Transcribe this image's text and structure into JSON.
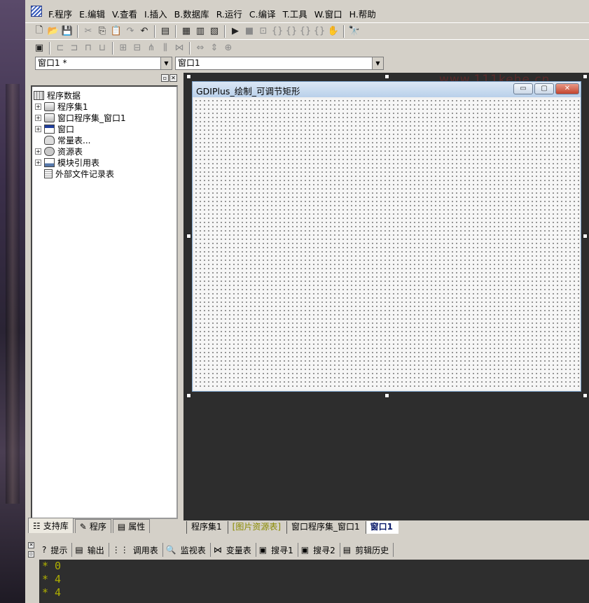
{
  "menubar": {
    "items": [
      "F.程序",
      "E.编辑",
      "V.查看",
      "I.插入",
      "B.数据库",
      "R.运行",
      "C.编译",
      "T.工具",
      "W.窗口",
      "H.帮助"
    ]
  },
  "toolbar1": {
    "icons": [
      "new-file-icon",
      "open-folder-icon",
      "save-icon",
      "cut-icon",
      "copy-icon",
      "paste-icon",
      "redo-icon",
      "undo-icon",
      "find-icon",
      "layout1-icon",
      "layout2-icon",
      "layout3-icon",
      "run-icon",
      "stop-icon",
      "step-icon",
      "step-in-icon",
      "step-out-icon",
      "step-over-icon",
      "breakpoint-icon",
      "hand-icon",
      "binoculars-icon"
    ]
  },
  "combos": {
    "left_value": "窗口1 *",
    "right_value": "窗口1"
  },
  "tree": {
    "root_label": "程序数据",
    "items": [
      {
        "label": "程序集1",
        "icon": "assembly-icon",
        "expandable": true
      },
      {
        "label": "窗口程序集_窗口1",
        "icon": "assembly-icon",
        "expandable": true
      },
      {
        "label": "窗口",
        "icon": "window-icon",
        "expandable": true
      },
      {
        "label": "常量表...",
        "icon": "constants-icon",
        "expandable": false
      },
      {
        "label": "资源表",
        "icon": "resource-icon",
        "expandable": true
      },
      {
        "label": "模块引用表",
        "icon": "module-icon",
        "expandable": true
      },
      {
        "label": "外部文件记录表",
        "icon": "document-icon",
        "expandable": false
      }
    ]
  },
  "left_tabs": {
    "support": "支持库",
    "program": "程序",
    "property": "属性"
  },
  "watermark": "www.111kehe.cn",
  "form": {
    "title": "GDIPlus_绘制_可调节矩形",
    "min_glyph": "▭",
    "max_glyph": "▢",
    "close_glyph": "✕"
  },
  "doc_tabs": [
    "程序集1",
    "[图片资源表]",
    "窗口程序集_窗口1",
    "窗口1"
  ],
  "output_tabs": [
    "提示",
    "输出",
    "调用表",
    "监视表",
    "变量表",
    "搜寻1",
    "搜寻2",
    "剪辑历史"
  ],
  "console_lines": [
    "* 0",
    "* 4",
    "* 4"
  ],
  "colors": {
    "console_text": "#b0b000",
    "tab_highlight": "#8a8a00",
    "workspace": "#2d2d2d"
  }
}
